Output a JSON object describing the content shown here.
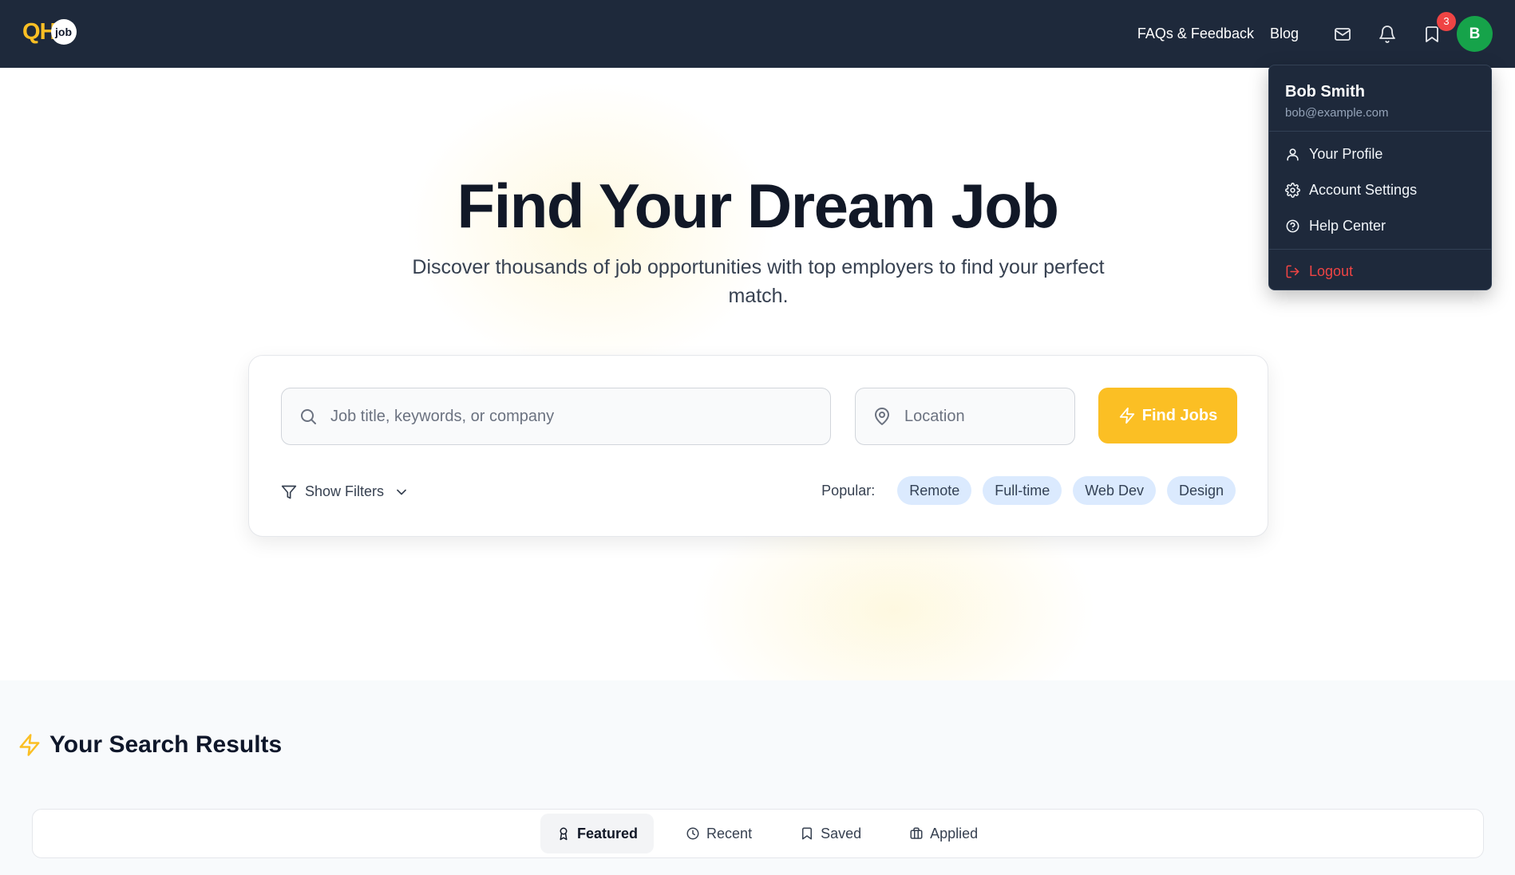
{
  "navbar": {
    "logo_text_q": "Q",
    "logo_text_h": "H",
    "logo_badge": "job",
    "links": {
      "faq": "FAQs & Feedback",
      "blog": "Blog"
    },
    "icons": [
      "mail-icon",
      "bell-icon",
      "bookmark-icon"
    ],
    "bookmark_count": "3",
    "avatar_initial": "B",
    "avatar_color": "#16a34a"
  },
  "hero": {
    "title": "Find Your Dream Job",
    "subtitle": "Discover thousands of job opportunities with top employers to find your perfect match."
  },
  "search": {
    "keyword_placeholder": "Job title, keywords, or company",
    "location_placeholder": "Location",
    "find_button": "Find Jobs",
    "show_filters": "Show Filters",
    "popular_label": "Popular:",
    "popular_tags": [
      "Remote",
      "Full-time",
      "Web Dev",
      "Design"
    ]
  },
  "results": {
    "title": "Your Search Results",
    "tabs": [
      {
        "label": "Featured",
        "icon": "award-icon",
        "active": true
      },
      {
        "label": "Recent",
        "icon": "clock-icon",
        "active": false
      },
      {
        "label": "Saved",
        "icon": "bookmark-icon",
        "active": false
      },
      {
        "label": "Applied",
        "icon": "briefcase-icon",
        "active": false
      }
    ]
  },
  "user_menu": {
    "name": "Bob Smith",
    "email": "bob@example.com",
    "items": [
      {
        "label": "Your Profile",
        "icon": "user-icon"
      },
      {
        "label": "Account Settings",
        "icon": "gear-icon"
      },
      {
        "label": "Help Center",
        "icon": "help-circle-icon"
      }
    ],
    "logout": "Logout"
  },
  "colors": {
    "navbar_bg": "#1e293b",
    "accent": "#fbbf24",
    "chip_bg": "#dbeafe",
    "danger": "#ef4444"
  }
}
